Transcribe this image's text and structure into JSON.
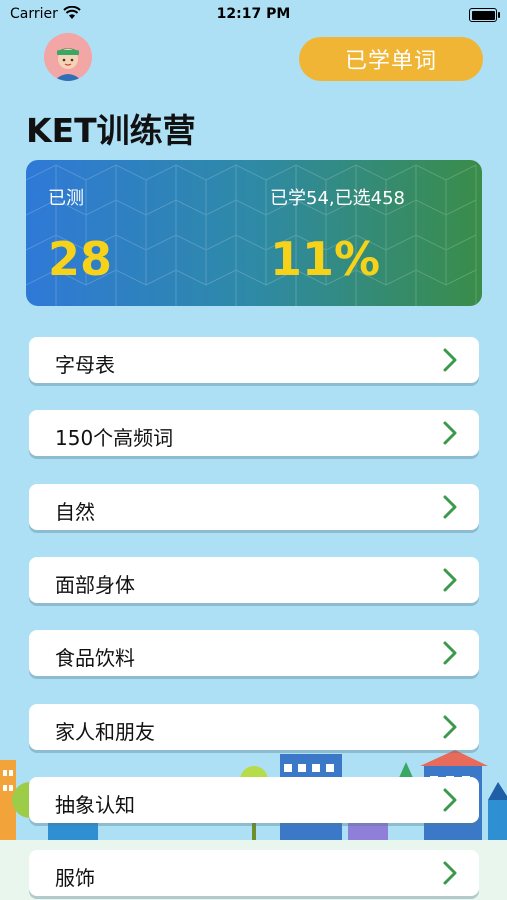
{
  "status": {
    "carrier": "Carrier",
    "time": "12:17 PM"
  },
  "header": {
    "learned_button": "已学单词",
    "title": "KET训练营"
  },
  "stats": {
    "tested_label": "已测",
    "tested_value": "28",
    "learned_label": "已学54,已选458",
    "learned_percent": "11%"
  },
  "menu": [
    {
      "label": "字母表"
    },
    {
      "label": "150个高频词"
    },
    {
      "label": "自然"
    },
    {
      "label": "面部身体"
    },
    {
      "label": "食品饮料"
    },
    {
      "label": "家人和朋友"
    },
    {
      "label": "抽象认知"
    },
    {
      "label": "服饰"
    }
  ],
  "colors": {
    "background": "#aee0f5",
    "accent": "#f0b534",
    "chevron": "#3a9a4a",
    "stat_value": "#f7d21b"
  }
}
